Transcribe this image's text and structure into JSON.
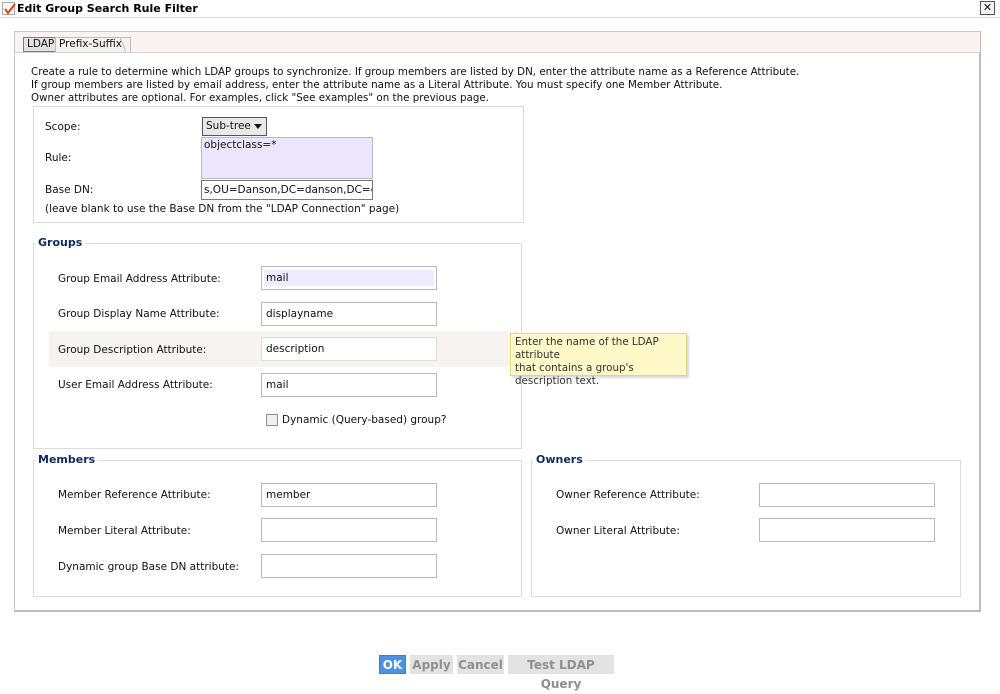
{
  "window": {
    "title": "Edit Group Search Rule Filter",
    "close_glyph": "✕"
  },
  "tabs": [
    {
      "label": "LDAP",
      "active": true
    },
    {
      "label": "Prefix-Suffix",
      "active": false
    }
  ],
  "intro": {
    "line1": "Create a rule to determine which LDAP groups to synchronize. If group members are listed by DN, enter the attribute name as a Reference Attribute.",
    "line2": "If group members are listed by email address, enter the attribute name as a Literal Attribute. You must specify one Member Attribute.",
    "line3": "Owner attributes are optional. For examples, click \"See examples\" on the previous page."
  },
  "rule_section": {
    "scope_label": "Scope:",
    "scope_value": "Sub-tree",
    "rule_label": "Rule:",
    "rule_value": "objectclass=*",
    "base_dn_label": "Base DN:",
    "base_dn_value": "s,OU=Danson,DC=danson,DC=com",
    "base_dn_hint": "(leave blank to use the Base DN from the \"LDAP Connection\" page)"
  },
  "groups": {
    "legend": "Groups",
    "email_attr_label": "Group Email Address Attribute:",
    "email_attr_value": "mail",
    "display_attr_label": "Group Display Name Attribute:",
    "display_attr_value": "displayname",
    "desc_attr_label": "Group Description Attribute:",
    "desc_attr_value": "description",
    "user_email_label": "User Email Address Attribute:",
    "user_email_value": "mail",
    "dynamic_label": "Dynamic (Query-based) group?",
    "dynamic_checked": false
  },
  "tooltip": {
    "line1": "Enter the name of the LDAP attribute",
    "line2": "that contains a group's",
    "line3": "description text."
  },
  "members": {
    "legend": "Members",
    "ref_label": "Member Reference Attribute:",
    "ref_value": "member",
    "literal_label": "Member Literal Attribute:",
    "literal_value": "",
    "dyn_base_label": "Dynamic group Base DN attribute:",
    "dyn_base_value": ""
  },
  "owners": {
    "legend": "Owners",
    "ref_label": "Owner Reference Attribute:",
    "ref_value": "",
    "literal_label": "Owner Literal Attribute:",
    "literal_value": ""
  },
  "buttons": {
    "ok": "OK",
    "apply": "Apply",
    "cancel": "Cancel",
    "test": "Test LDAP Query"
  }
}
